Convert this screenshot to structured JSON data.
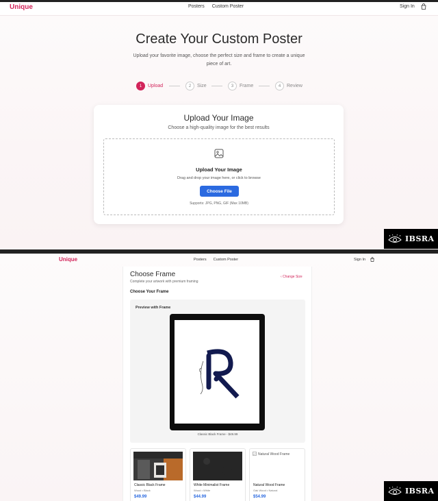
{
  "screen1": {
    "nav": {
      "logo": "Unique",
      "links": [
        "Posters",
        "Custom Poster"
      ],
      "signin": "Sign In",
      "cart_icon": "shopping-bag-icon"
    },
    "hero": {
      "title": "Create Your Custom Poster",
      "subtitle": "Upload your favorite image, choose the perfect size and frame to create a unique piece of art."
    },
    "steps": [
      {
        "num": "1",
        "label": "Upload",
        "active": true
      },
      {
        "num": "2",
        "label": "Size",
        "active": false
      },
      {
        "num": "3",
        "label": "Frame",
        "active": false
      },
      {
        "num": "4",
        "label": "Review",
        "active": false
      }
    ],
    "upload_card": {
      "title": "Upload Your Image",
      "subtitle": "Choose a high-quality image for the best results",
      "drop_title": "Upload Your Image",
      "drop_sub": "Drag and drop your image here, or click to browse",
      "button": "Choose File",
      "supports": "Supports: JPG, PNG, GIF (Max 10MB)"
    }
  },
  "badge": {
    "text": "IBSRA"
  },
  "screen2": {
    "nav": {
      "logo": "Unique",
      "links": [
        "Posters",
        "Custom Poster"
      ],
      "signin": "Sign In"
    },
    "panel": {
      "title": "Choose Frame",
      "subtitle": "Complete your artwork with premium framing",
      "change_size": "‹ Change Size",
      "section": "Choose Your Frame",
      "preview_label": "Preview with Frame",
      "preview_caption": "Classic Black Frame - $49.99"
    },
    "frames": [
      {
        "name": "Classic Black Frame",
        "material": "Wood • Black",
        "price": "$49.99"
      },
      {
        "name": "White Minimalist Frame",
        "material": "Wood • White",
        "price": "$44.99"
      },
      {
        "name": "Natural Wood Frame",
        "material": "Oak Wood • Natural",
        "price": "$54.99",
        "alt": "Natural Wood Frame"
      }
    ]
  },
  "colors": {
    "accent": "#d2245a",
    "button": "#2b6ae0"
  }
}
